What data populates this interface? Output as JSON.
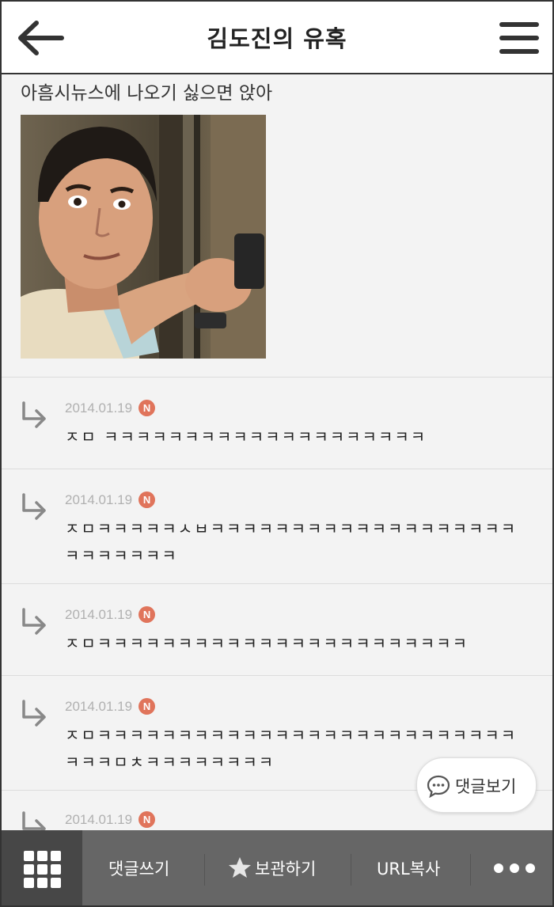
{
  "header": {
    "title": "김도진의 유혹",
    "back_icon": "back-arrow-icon",
    "menu_icon": "hamburger-menu-icon"
  },
  "post": {
    "text": "아흠시뉴스에 나오기 싫으면 앉아"
  },
  "comments": [
    {
      "date": "2014.01.19",
      "badge": "N",
      "text": "ㅈㅁ ㅋㅋㅋㅋㅋㅋㅋㅋㅋㅋㅋㅋㅋㅋㅋㅋㅋㅋㅋㅋ"
    },
    {
      "date": "2014.01.19",
      "badge": "N",
      "text": "ㅈㅁㅋㅋㅋㅋㅋㅅㅂㅋㅋㅋㅋㅋㅋㅋㅋㅋㅋㅋㅋㅋㅋㅋㅋㅋㅋㅋㅋㅋㅋㅋㅋㅋㅋ"
    },
    {
      "date": "2014.01.19",
      "badge": "N",
      "text": "ㅈㅁㅋㅋㅋㅋㅋㅋㅋㅋㅋㅋㅋㅋㅋㅋㅋㅋㅋㅋㅋㅋㅋㅋㅋ"
    },
    {
      "date": "2014.01.19",
      "badge": "N",
      "text": "ㅈㅁㅋㅋㅋㅋㅋㅋㅋㅋㅋㅋㅋㅋㅋㅋㅋㅋㅋㅋㅋㅋㅋㅋㅋㅋㅋㅋㅋㅋㅋㅁㅊㅋㅋㅋㅋㅋㅋㅋㅋ"
    },
    {
      "date": "2014.01.19",
      "badge": "N",
      "text": ""
    }
  ],
  "floating": {
    "view_comments_label": "댓글보기",
    "icon": "chat-bubble-icon"
  },
  "bottom_bar": {
    "grid_icon": "grid-icon",
    "write_comment": "댓글쓰기",
    "save": "보관하기",
    "save_icon": "star-icon",
    "copy_url": "URL복사",
    "more_icon": "more-dots-icon"
  },
  "colors": {
    "badge": "#e0745b",
    "bottom_bar": "#666666",
    "grid_button": "#474747"
  }
}
